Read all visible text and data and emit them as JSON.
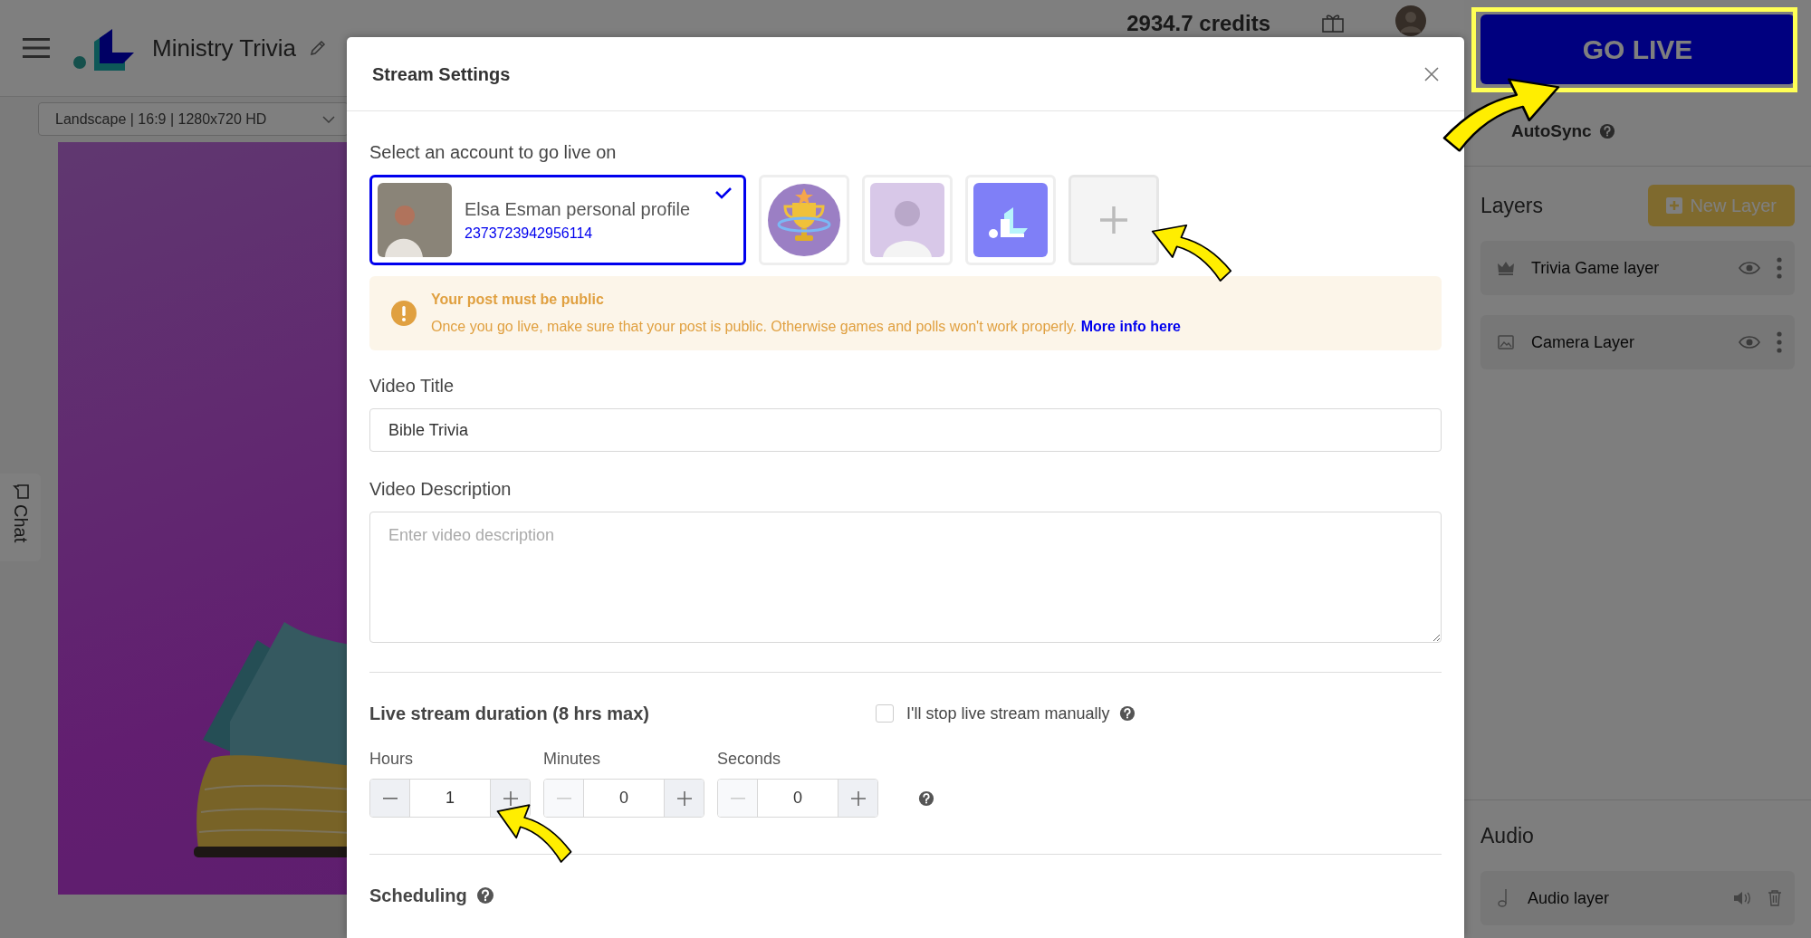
{
  "app_header": {
    "title": "Ministry Trivia",
    "credits": "2934.7 credits",
    "format": "Landscape | 16:9 | 1280x720 HD"
  },
  "side_tab": {
    "label": "Chat"
  },
  "right_panel": {
    "go_live": "GO LIVE",
    "autosync": "AutoSync",
    "layers_title": "Layers",
    "new_layer": "New Layer",
    "layers": [
      {
        "kind": "game",
        "name": "Trivia Game layer"
      },
      {
        "kind": "camera",
        "name": "Camera Layer"
      }
    ],
    "audio_title": "Audio",
    "audio_layers": [
      {
        "name": "Audio layer"
      }
    ]
  },
  "modal": {
    "title": "Stream Settings",
    "account_label": "Select an account to go live on",
    "accounts": [
      {
        "kind": "profile",
        "name": "Elsa Esman personal profile",
        "id": "2373723942956114",
        "selected": true
      },
      {
        "kind": "trophy",
        "selected": false
      },
      {
        "kind": "photo",
        "selected": false
      },
      {
        "kind": "logo",
        "selected": false
      }
    ],
    "alert": {
      "title": "Your post must be public",
      "text": "Once you go live, make sure that your post is public. Otherwise games and polls won't work properly.",
      "link": "More info here"
    },
    "video_title": {
      "label": "Video Title",
      "value": "Bible Trivia"
    },
    "video_description": {
      "label": "Video Description",
      "placeholder": "Enter video description"
    },
    "duration": {
      "heading": "Live stream duration (8 hrs max)",
      "manual_stop": {
        "label": "I'll stop live stream manually",
        "checked": false
      },
      "fields": [
        {
          "label": "Hours",
          "value": "1",
          "decrement_disabled": false
        },
        {
          "label": "Minutes",
          "value": "0",
          "decrement_disabled": true
        },
        {
          "label": "Seconds",
          "value": "0",
          "decrement_disabled": true
        }
      ]
    },
    "scheduling": {
      "heading": "Scheduling"
    }
  }
}
